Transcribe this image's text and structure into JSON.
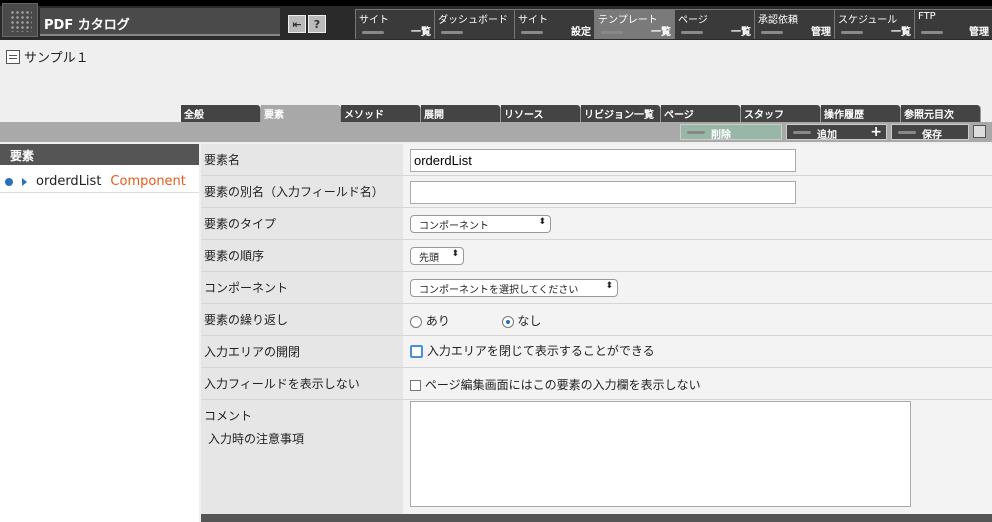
{
  "app": {
    "title": "PDF カタログ"
  },
  "topnav": [
    {
      "top": "サイト",
      "bottom": "一覧"
    },
    {
      "top": "ダッシュボード",
      "bottom": ""
    },
    {
      "top": "サイト",
      "bottom": "設定"
    },
    {
      "top": "テンプレート",
      "bottom": "一覧"
    },
    {
      "top": "ページ",
      "bottom": "一覧"
    },
    {
      "top": "承認依頼",
      "bottom": "管理"
    },
    {
      "top": "スケジュール",
      "bottom": "一覧"
    },
    {
      "top": "FTP",
      "bottom": "管理"
    }
  ],
  "page": {
    "title": "サンプル１"
  },
  "tabs": [
    "全般",
    "要素",
    "メソッド",
    "展開",
    "リソース",
    "リビジョン一覧",
    "ページ",
    "スタッフ",
    "操作履歴",
    "参照元目次"
  ],
  "actions": {
    "delete": "削除",
    "add": "追加",
    "save": "保存"
  },
  "sidebar": {
    "heading": "要素",
    "item": {
      "name": "orderdList",
      "type": "Component"
    }
  },
  "form": {
    "name_label": "要素名",
    "name_value": "orderdList",
    "alias_label": "要素の別名（入力フィールド名）",
    "alias_value": "",
    "type_label": "要素のタイプ",
    "type_value": "コンポーネント",
    "order_label": "要素の順序",
    "order_value": "先頭",
    "component_label": "コンポーネント",
    "component_value": "コンポーネントを選択してください",
    "repeat_label": "要素の繰り返し",
    "repeat_yes": "あり",
    "repeat_no": "なし",
    "collapse_label": "入力エリアの開閉",
    "collapse_text": "入力エリアを閉じて表示することができる",
    "hide_label": "入力フィールドを表示しない",
    "hide_text": "ページ編集画面にはこの要素の入力欄を表示しない",
    "comment_label": "コメント",
    "comment_sub": "入力時の注意事項"
  }
}
